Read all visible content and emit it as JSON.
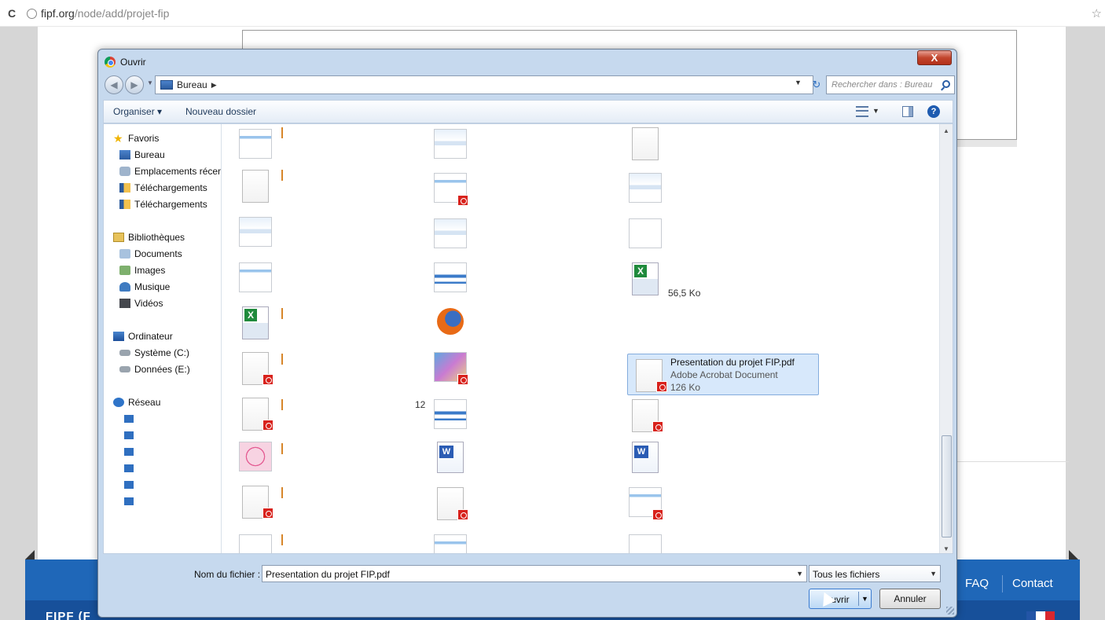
{
  "browser": {
    "url_host": "fipf.org",
    "url_path": "/node/add/projet-fip",
    "reload_glyph": "C",
    "star_glyph": "☆"
  },
  "page": {
    "footer": {
      "faq": "FAQ",
      "contact": "Contact",
      "brand": "FIPF (F"
    }
  },
  "dialog": {
    "title": "Ouvrir",
    "close_glyph": "X",
    "location": "Bureau",
    "search_placeholder": "Rechercher dans : Bureau",
    "toolbar": {
      "organize": "Organiser ▾",
      "new_folder": "Nouveau dossier"
    },
    "nav": {
      "favorites": "Favoris",
      "desktop": "Bureau",
      "recent": "Emplacements récents",
      "downloads_1": "Téléchargements",
      "downloads_2": "Téléchargements",
      "libraries": "Bibliothèques",
      "documents": "Documents",
      "images": "Images",
      "music": "Musique",
      "videos": "Vidéos",
      "computer": "Ordinateur",
      "system": "Système (C:)",
      "data": "Données (E:)",
      "network": "Réseau"
    },
    "files": {
      "size_label": "56,5 Ko",
      "number_label": "12",
      "selected": {
        "name": "Presentation du projet FIP.pdf",
        "type": "Adobe Acrobat Document",
        "size": "126 Ko"
      }
    },
    "filename_label": "Nom du fichier :",
    "filename_value": "Presentation du projet FIP.pdf",
    "filter_value": "Tous les fichiers",
    "open_button": "Ouvrir",
    "cancel_button": "Annuler"
  }
}
